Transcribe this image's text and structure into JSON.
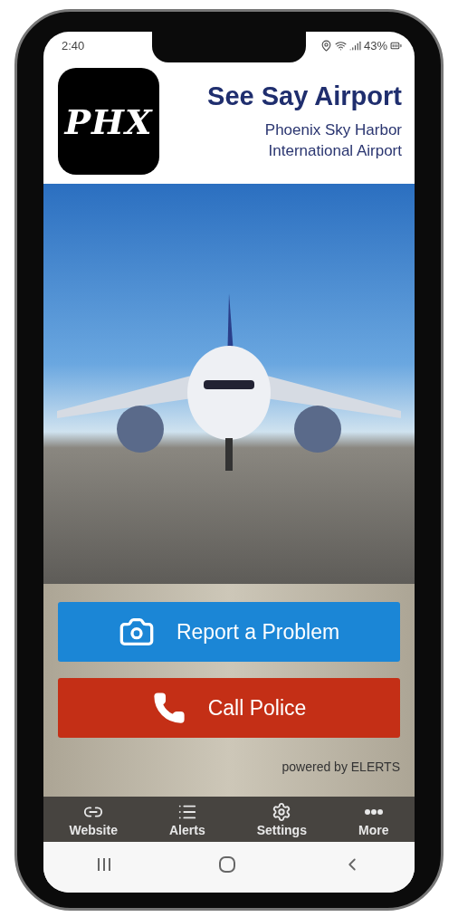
{
  "status_bar": {
    "time": "2:40",
    "battery": "43%"
  },
  "header": {
    "logo_text": "PHX",
    "title": "See Say Airport",
    "subtitle_lines": [
      "Phoenix Sky Harbor",
      "International Airport"
    ]
  },
  "actions": [
    {
      "label": "Report a Problem",
      "kind": "camera"
    },
    {
      "label": "Call Police",
      "kind": "phone"
    }
  ],
  "powered_by": "powered by ELERTS",
  "tabs": [
    {
      "label": "Website",
      "kind": "link"
    },
    {
      "label": "Alerts",
      "kind": "list"
    },
    {
      "label": "Settings",
      "kind": "gear"
    },
    {
      "label": "More",
      "kind": "more"
    }
  ]
}
